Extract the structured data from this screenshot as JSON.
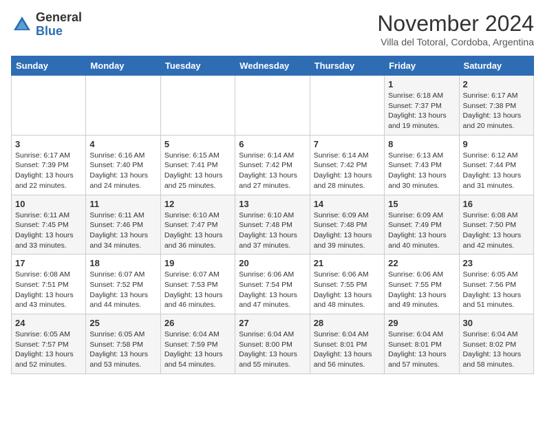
{
  "logo": {
    "text_general": "General",
    "text_blue": "Blue"
  },
  "header": {
    "month_year": "November 2024",
    "location": "Villa del Totoral, Cordoba, Argentina"
  },
  "weekdays": [
    "Sunday",
    "Monday",
    "Tuesday",
    "Wednesday",
    "Thursday",
    "Friday",
    "Saturday"
  ],
  "weeks": [
    [
      {
        "day": "",
        "info": ""
      },
      {
        "day": "",
        "info": ""
      },
      {
        "day": "",
        "info": ""
      },
      {
        "day": "",
        "info": ""
      },
      {
        "day": "",
        "info": ""
      },
      {
        "day": "1",
        "info": "Sunrise: 6:18 AM\nSunset: 7:37 PM\nDaylight: 13 hours\nand 19 minutes."
      },
      {
        "day": "2",
        "info": "Sunrise: 6:17 AM\nSunset: 7:38 PM\nDaylight: 13 hours\nand 20 minutes."
      }
    ],
    [
      {
        "day": "3",
        "info": "Sunrise: 6:17 AM\nSunset: 7:39 PM\nDaylight: 13 hours\nand 22 minutes."
      },
      {
        "day": "4",
        "info": "Sunrise: 6:16 AM\nSunset: 7:40 PM\nDaylight: 13 hours\nand 24 minutes."
      },
      {
        "day": "5",
        "info": "Sunrise: 6:15 AM\nSunset: 7:41 PM\nDaylight: 13 hours\nand 25 minutes."
      },
      {
        "day": "6",
        "info": "Sunrise: 6:14 AM\nSunset: 7:42 PM\nDaylight: 13 hours\nand 27 minutes."
      },
      {
        "day": "7",
        "info": "Sunrise: 6:14 AM\nSunset: 7:42 PM\nDaylight: 13 hours\nand 28 minutes."
      },
      {
        "day": "8",
        "info": "Sunrise: 6:13 AM\nSunset: 7:43 PM\nDaylight: 13 hours\nand 30 minutes."
      },
      {
        "day": "9",
        "info": "Sunrise: 6:12 AM\nSunset: 7:44 PM\nDaylight: 13 hours\nand 31 minutes."
      }
    ],
    [
      {
        "day": "10",
        "info": "Sunrise: 6:11 AM\nSunset: 7:45 PM\nDaylight: 13 hours\nand 33 minutes."
      },
      {
        "day": "11",
        "info": "Sunrise: 6:11 AM\nSunset: 7:46 PM\nDaylight: 13 hours\nand 34 minutes."
      },
      {
        "day": "12",
        "info": "Sunrise: 6:10 AM\nSunset: 7:47 PM\nDaylight: 13 hours\nand 36 minutes."
      },
      {
        "day": "13",
        "info": "Sunrise: 6:10 AM\nSunset: 7:48 PM\nDaylight: 13 hours\nand 37 minutes."
      },
      {
        "day": "14",
        "info": "Sunrise: 6:09 AM\nSunset: 7:48 PM\nDaylight: 13 hours\nand 39 minutes."
      },
      {
        "day": "15",
        "info": "Sunrise: 6:09 AM\nSunset: 7:49 PM\nDaylight: 13 hours\nand 40 minutes."
      },
      {
        "day": "16",
        "info": "Sunrise: 6:08 AM\nSunset: 7:50 PM\nDaylight: 13 hours\nand 42 minutes."
      }
    ],
    [
      {
        "day": "17",
        "info": "Sunrise: 6:08 AM\nSunset: 7:51 PM\nDaylight: 13 hours\nand 43 minutes."
      },
      {
        "day": "18",
        "info": "Sunrise: 6:07 AM\nSunset: 7:52 PM\nDaylight: 13 hours\nand 44 minutes."
      },
      {
        "day": "19",
        "info": "Sunrise: 6:07 AM\nSunset: 7:53 PM\nDaylight: 13 hours\nand 46 minutes."
      },
      {
        "day": "20",
        "info": "Sunrise: 6:06 AM\nSunset: 7:54 PM\nDaylight: 13 hours\nand 47 minutes."
      },
      {
        "day": "21",
        "info": "Sunrise: 6:06 AM\nSunset: 7:55 PM\nDaylight: 13 hours\nand 48 minutes."
      },
      {
        "day": "22",
        "info": "Sunrise: 6:06 AM\nSunset: 7:55 PM\nDaylight: 13 hours\nand 49 minutes."
      },
      {
        "day": "23",
        "info": "Sunrise: 6:05 AM\nSunset: 7:56 PM\nDaylight: 13 hours\nand 51 minutes."
      }
    ],
    [
      {
        "day": "24",
        "info": "Sunrise: 6:05 AM\nSunset: 7:57 PM\nDaylight: 13 hours\nand 52 minutes."
      },
      {
        "day": "25",
        "info": "Sunrise: 6:05 AM\nSunset: 7:58 PM\nDaylight: 13 hours\nand 53 minutes."
      },
      {
        "day": "26",
        "info": "Sunrise: 6:04 AM\nSunset: 7:59 PM\nDaylight: 13 hours\nand 54 minutes."
      },
      {
        "day": "27",
        "info": "Sunrise: 6:04 AM\nSunset: 8:00 PM\nDaylight: 13 hours\nand 55 minutes."
      },
      {
        "day": "28",
        "info": "Sunrise: 6:04 AM\nSunset: 8:01 PM\nDaylight: 13 hours\nand 56 minutes."
      },
      {
        "day": "29",
        "info": "Sunrise: 6:04 AM\nSunset: 8:01 PM\nDaylight: 13 hours\nand 57 minutes."
      },
      {
        "day": "30",
        "info": "Sunrise: 6:04 AM\nSunset: 8:02 PM\nDaylight: 13 hours\nand 58 minutes."
      }
    ]
  ]
}
